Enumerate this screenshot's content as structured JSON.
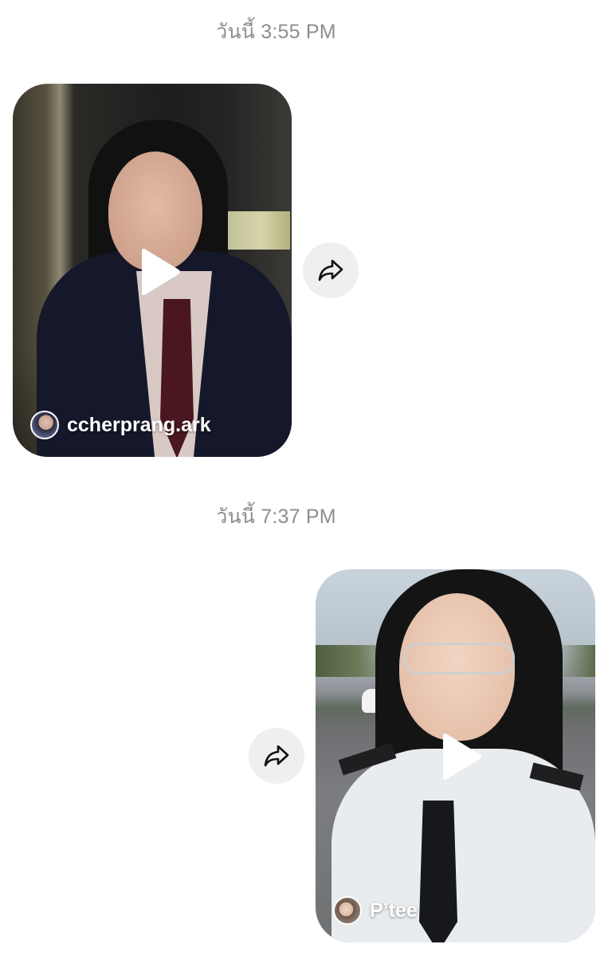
{
  "messages": [
    {
      "timestamp": "วันนี้ 3:55 PM",
      "reel": {
        "author": "ccherprang.ark",
        "align": "left"
      }
    },
    {
      "timestamp": "วันนี้ 7:37 PM",
      "reel": {
        "author": "P’tee",
        "align": "right"
      }
    }
  ],
  "icons": {
    "play": "play-icon",
    "share": "share-arrow-icon",
    "avatar": "avatar"
  },
  "colors": {
    "timestamp_text": "#8e8e8e",
    "share_button_bg": "#efefef",
    "author_text": "#ffffff"
  }
}
